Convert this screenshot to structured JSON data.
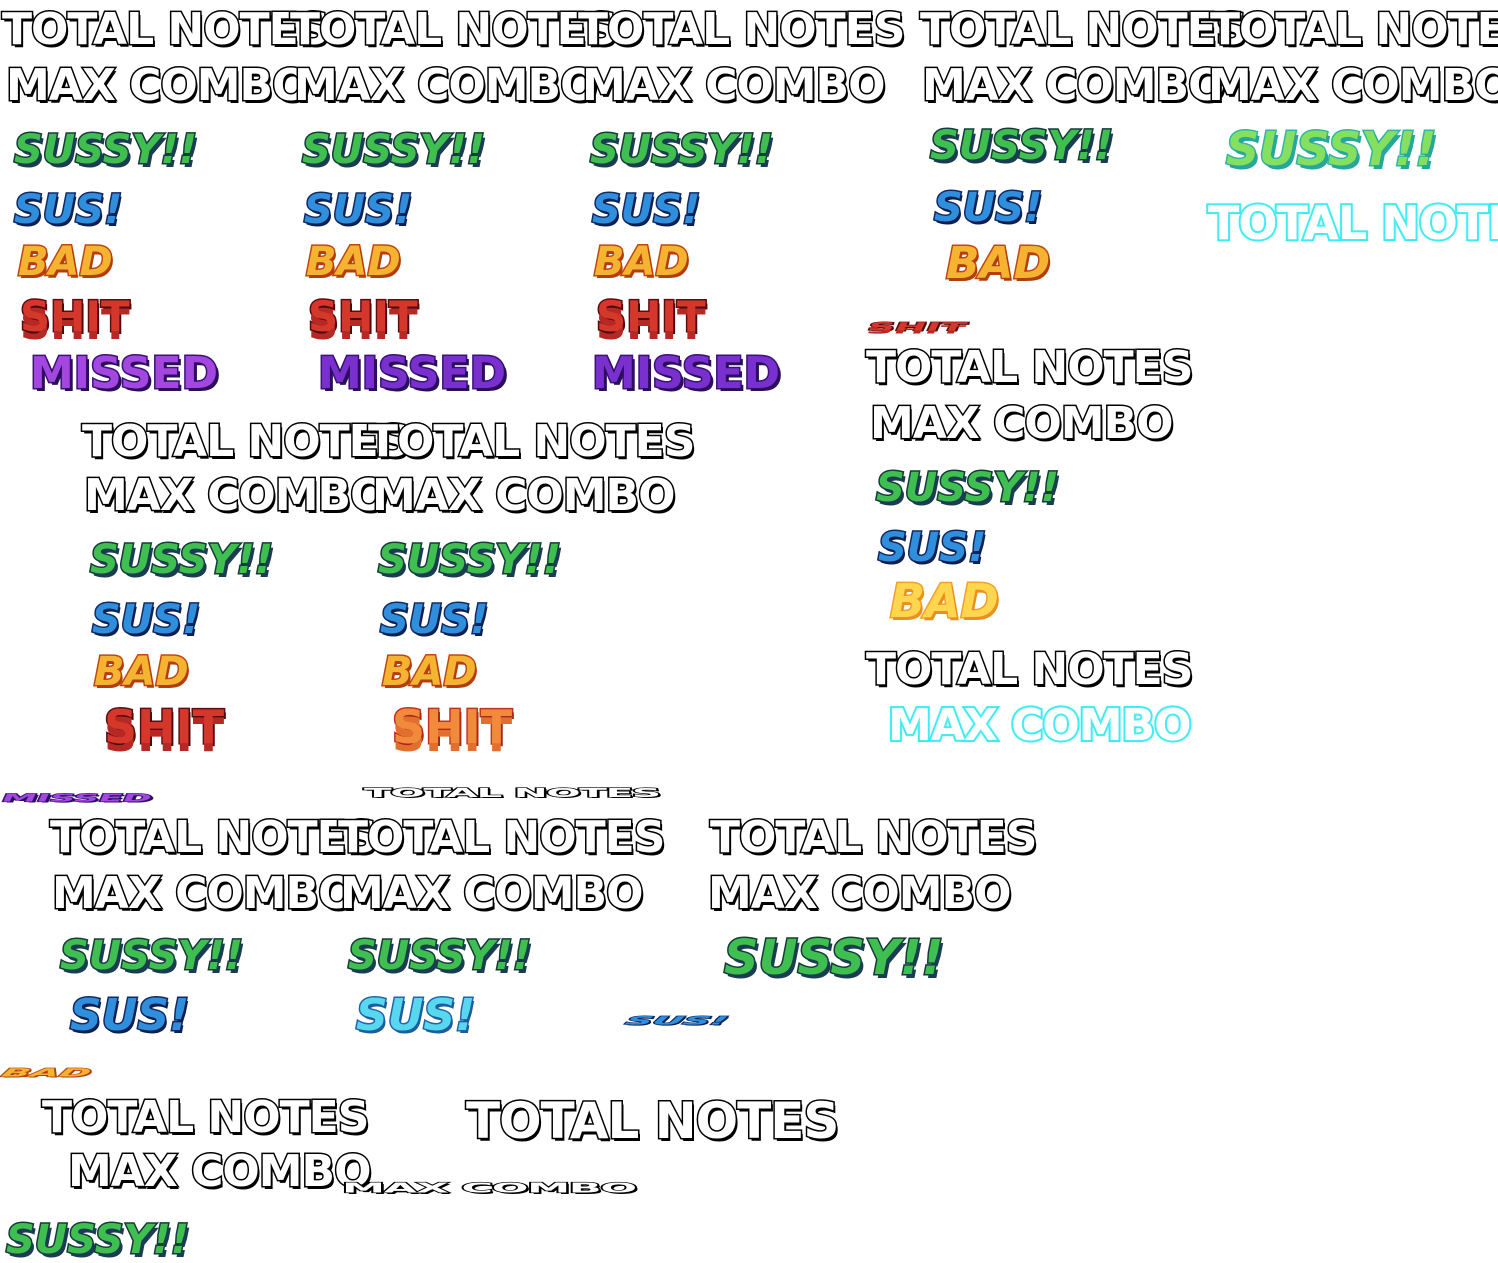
{
  "labels": {
    "total_notes": "TOTAL NOTES",
    "max_combo": "MAX COMBO",
    "sussy": "SUSSY!!",
    "sus": "SUS!",
    "bad": "BAD",
    "shit": "SHIT",
    "missed": "MISSED"
  },
  "colors": {
    "outline_white_text": "#ffffff",
    "sussy_green": "#3fbf4f",
    "sus_blue": "#2f8fdd",
    "bad_yellow": "#f4b431",
    "shit_red": "#d6372b",
    "missed_purple": "#a446e0",
    "glow_cyan": "#35e9f2",
    "background": "#ffffff"
  }
}
